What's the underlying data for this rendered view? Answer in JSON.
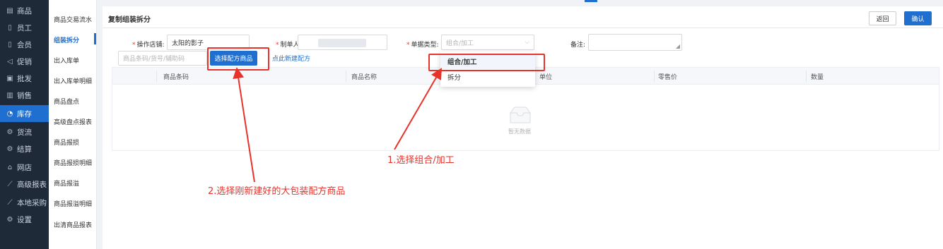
{
  "nav": {
    "items": [
      {
        "icon": "goods-icon",
        "glyph": "▤",
        "label": "商品"
      },
      {
        "icon": "staff-icon",
        "glyph": "▯",
        "label": "员工"
      },
      {
        "icon": "member-icon",
        "glyph": "▯",
        "label": "会员"
      },
      {
        "icon": "promo-icon",
        "glyph": "◁",
        "label": "促销"
      },
      {
        "icon": "wholesale-icon",
        "glyph": "▣",
        "label": "批发"
      },
      {
        "icon": "sales-icon",
        "glyph": "▥",
        "label": "销售"
      },
      {
        "icon": "inventory-icon",
        "glyph": "◔",
        "label": "库存"
      },
      {
        "icon": "logistics-icon",
        "glyph": "⚙",
        "label": "货流"
      },
      {
        "icon": "settle-icon",
        "glyph": "⚙",
        "label": "结算"
      },
      {
        "icon": "store-icon",
        "glyph": "⌂",
        "label": "网店"
      },
      {
        "icon": "report-icon",
        "glyph": "⟋",
        "label": "高级报表"
      },
      {
        "icon": "purchase-icon",
        "glyph": "⟋",
        "label": "本地采购"
      },
      {
        "icon": "settings-icon",
        "glyph": "⚙",
        "label": "设置"
      }
    ],
    "active_index": 6
  },
  "submenu": {
    "items": [
      "商品交易流水",
      "组装拆分",
      "出入库单",
      "出入库单明细",
      "商品盘点",
      "高级盘点报表",
      "商品报损",
      "商品报损明细",
      "商品报溢",
      "商品报溢明细",
      "出清商品报表"
    ],
    "active_index": 1
  },
  "page": {
    "title": "复制组装拆分",
    "back_label": "返回",
    "confirm_label": "确认"
  },
  "form": {
    "store_label": "操作店铺:",
    "store_value": "太阳的影子",
    "maker_label": "制单人:",
    "type_label": "单据类型:",
    "type_placeholder": "组合/加工",
    "remark_label": "备注:",
    "search_placeholder": "商品条码/货号/辅助码",
    "select_button": "选择配方商品",
    "new_link": "点此新建配方"
  },
  "table": {
    "columns": [
      "商品条码",
      "商品名称",
      "单位",
      "零售价",
      "数量"
    ],
    "empty_text": "暂无数据"
  },
  "dropdown": {
    "options": [
      "组合/加工",
      "拆分"
    ],
    "selected_index": 0
  },
  "annotations": {
    "step1": "1.选择组合/加工",
    "step2": "2.选择刚新建好的大包装配方商品",
    "color": "#e8322a"
  },
  "colors": {
    "accent": "#1f6fd1",
    "nav_bg": "#1f2a38"
  }
}
